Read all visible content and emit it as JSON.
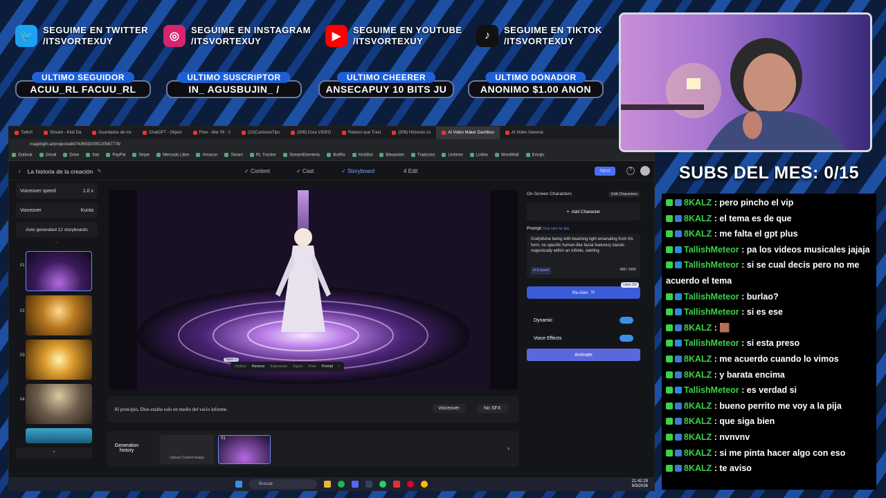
{
  "social": [
    {
      "icon": "twitter-icon",
      "line1": "SEGUIME EN TWITTER",
      "line2": "/ITSVORTEXUY",
      "color": "#1da1f2",
      "glyph": "🐦"
    },
    {
      "icon": "instagram-icon",
      "line1": "SEGUIME EN INSTAGRAM",
      "line2": "/ITSVORTEXUY",
      "color": "#d6246e",
      "glyph": "◎"
    },
    {
      "icon": "youtube-icon",
      "line1": "SEGUIME EN YOUTUBE",
      "line2": "/ITSVORTEXUY",
      "color": "#ff0000",
      "glyph": "▶"
    },
    {
      "icon": "tiktok-icon",
      "line1": "SEGUIME EN TIKTOK",
      "line2": "/ITSVORTEXUY",
      "color": "#111111",
      "glyph": "♪"
    }
  ],
  "pills": [
    {
      "label": "ULTIMO SEGUIDOR",
      "value": "ACUU_RL        FACUU_RL"
    },
    {
      "label": "ULTIMO SUSCRIPTOR",
      "value": "IN_        AGUSBUJIN_       /"
    },
    {
      "label": "ULTIMO CHEERER",
      "value": "ANSECAPUY 10 BITS       JU"
    },
    {
      "label": "ULTIMO DONADOR",
      "value": "ANONIMO $1.00        ANON"
    }
  ],
  "browser": {
    "tabs": [
      "Twitch",
      "Stream - Kick Da",
      "Guardados de Ins",
      "ChatGPT - Object",
      "Flow - Mar 09 - 2",
      "(10)CartoonsTips",
      "(308) Crea VIDEO",
      "Relatos que Trast",
      "(308) Historias co",
      "AI Video Maker Dashbou",
      "AI Video Generat"
    ],
    "active_tab": 9,
    "url": "magiclight.ai/project/edit/7436932009120587778/",
    "bookmarks": [
      "Outlook",
      "Gmail",
      "Drive",
      "Itaú",
      "PayPal",
      "Stripe",
      "Mercado Libre",
      "Amazon",
      "Steam",
      "RL Tracker",
      "StreamElements",
      "BotRix",
      "KickBot",
      "Bitwarden",
      "Traductor",
      "Linktree",
      "Linktw",
      "WordWall",
      "Emojis"
    ]
  },
  "app": {
    "title": "La historia de la creación",
    "steps": [
      "Content",
      "Cast",
      "Storyboard",
      "Edit"
    ],
    "step_nums": [
      "4"
    ],
    "next": "Next",
    "voiceover_speed_label": "Voiceover speed",
    "voiceover_speed_value": "1.0 x",
    "voiceover_label": "Voiceover",
    "voiceover_value": "Kunta",
    "auto_generated": "Auto generated 12 storyboards",
    "thumb_nums": [
      "01",
      "02",
      "03",
      "04"
    ],
    "onscreen_characters": "On-Screen Characters",
    "edit_characters": "Edit Characters",
    "add_character": "Add Character",
    "prompt_label": "Prompt",
    "prompt_tips": "Click here for tips",
    "prompt_text": "God(divine being with beaming light emanating from his form, no specific human-like facial features) stands majestically within an infinite, swirling",
    "ai_expand": "AI Expand",
    "char_count": "468 / 1000",
    "uses": "Uses 2/2",
    "regen": "Re-Gen",
    "regen_cost": "10",
    "dynamic": "Dynamic",
    "voice_effects": "Voice Effects",
    "animate": "Animate",
    "caption": "Al principio, Dios estaba solo en medio del vacío informe.",
    "voiceover_btn": "Voiceover",
    "no_sfx": "No SFX",
    "generation_history": "Generation history",
    "upload_custom": "Upload Custom Image",
    "gen_num": "01",
    "tools": [
      "Clothes",
      "Remove",
      "Expression",
      "Figure",
      "Pose",
      "Prompt"
    ],
    "nano_tag": "Nano 2"
  },
  "taskbar": {
    "search": "Buscar",
    "time": "21:42:29",
    "date": "9/3/2026"
  },
  "subs": "SUBS DEL MES: 0/15",
  "chat": [
    {
      "user": "8KALZ",
      "text": "pero pincho el vip",
      "color": "#3bd14a",
      "badge2": false
    },
    {
      "user": "8KALZ",
      "text": "el tema es de que",
      "color": "#3bd14a",
      "badge2": false
    },
    {
      "user": "8KALZ",
      "text": "me falta el gpt plus",
      "color": "#3bd14a",
      "badge2": false
    },
    {
      "user": "TallishMeteor",
      "text": "pa los videos musicales jajaja",
      "color": "#3bd14a",
      "badge2": true
    },
    {
      "user": "TallishMeteor",
      "text": "si se cual decis pero no me acuerdo el tema",
      "color": "#3bd14a",
      "badge2": true
    },
    {
      "user": "TallishMeteor",
      "text": "burlao?",
      "color": "#3bd14a",
      "badge2": true
    },
    {
      "user": "TallishMeteor",
      "text": "si es ese",
      "color": "#3bd14a",
      "badge2": true
    },
    {
      "user": "8KALZ",
      "text": "🟫",
      "color": "#3bd14a",
      "badge2": false
    },
    {
      "user": "TallishMeteor",
      "text": "si esta preso",
      "color": "#3bd14a",
      "badge2": true
    },
    {
      "user": "8KALZ",
      "text": "me acuerdo cuando lo vimos",
      "color": "#3bd14a",
      "badge2": false
    },
    {
      "user": "8KALZ",
      "text": "y barata encima",
      "color": "#3bd14a",
      "badge2": false
    },
    {
      "user": "TallishMeteor",
      "text": "es verdad si",
      "color": "#3bd14a",
      "badge2": true
    },
    {
      "user": "8KALZ",
      "text": "bueno perrito me voy a la pija",
      "color": "#3bd14a",
      "badge2": false
    },
    {
      "user": "8KALZ",
      "text": "que siga bien",
      "color": "#3bd14a",
      "badge2": false
    },
    {
      "user": "8KALZ",
      "text": "nvnvnv",
      "color": "#3bd14a",
      "badge2": false
    },
    {
      "user": "8KALZ",
      "text": "si me pinta hacer algo con eso",
      "color": "#3bd14a",
      "badge2": false
    },
    {
      "user": "8KALZ",
      "text": "te aviso",
      "color": "#3bd14a",
      "badge2": false
    }
  ]
}
